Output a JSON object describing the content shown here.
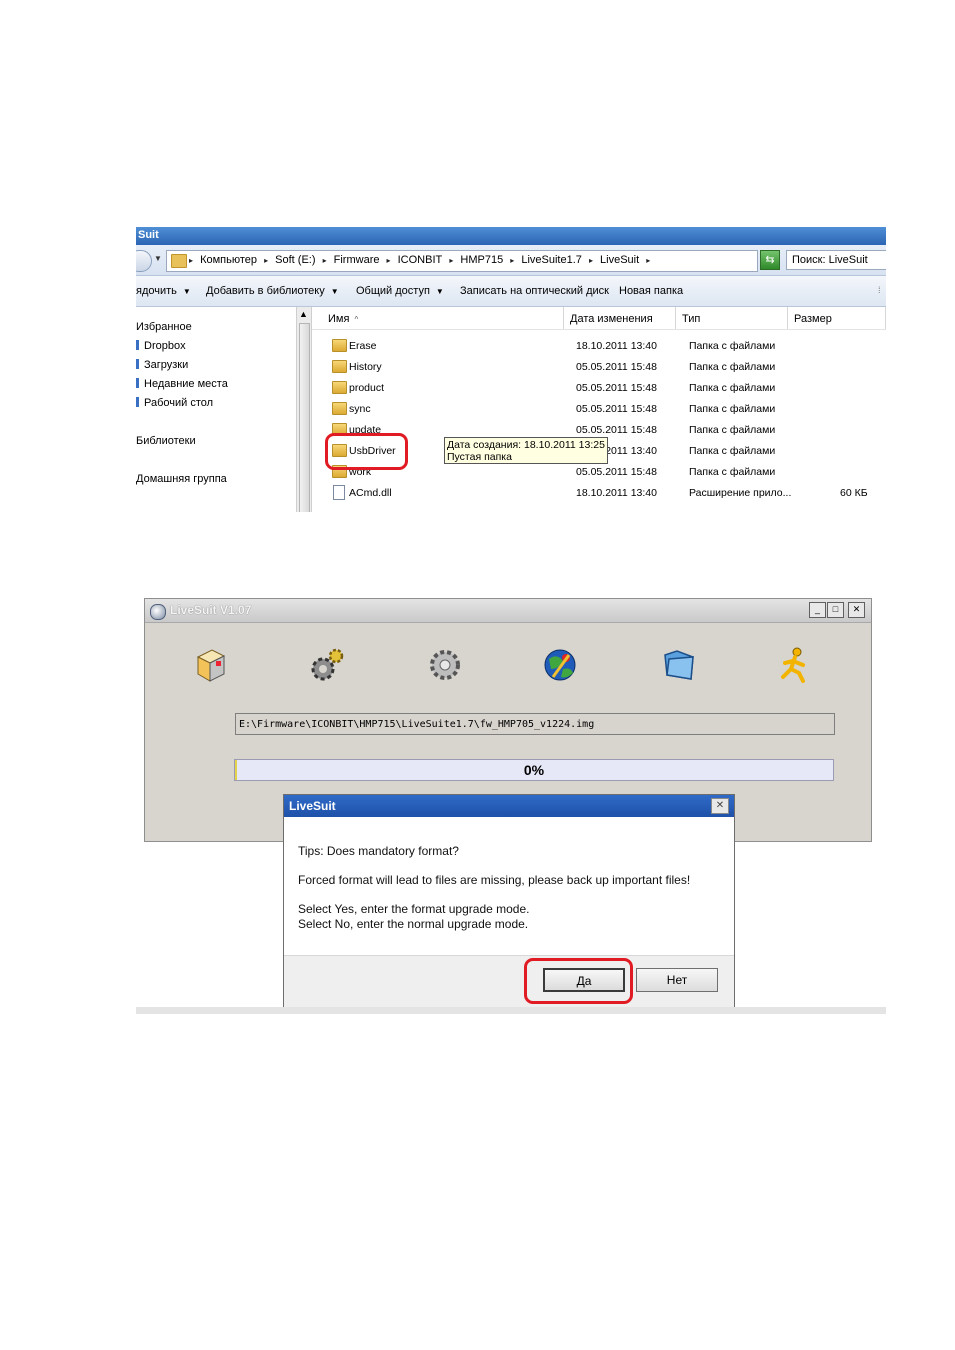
{
  "explorer": {
    "title": "Suit",
    "breadcrumbs": [
      "Компьютер",
      "Soft (E:)",
      "Firmware",
      "ICONBIT",
      "HMP715",
      "LiveSuite1.7",
      "LiveSuit"
    ],
    "search_placeholder": "Поиск: LiveSuit",
    "commands": [
      "ядочить",
      "Добавить в библиотеку",
      "Общий доступ",
      "Записать на оптический диск",
      "Новая папка"
    ],
    "nav": [
      "Избранное",
      "Dropbox",
      "Загрузки",
      "Недавние места",
      "Рабочий стол",
      "Библиотеки",
      "Домашняя группа"
    ],
    "columns": [
      "Имя",
      "Дата изменения",
      "Тип",
      "Размер"
    ],
    "rows": [
      {
        "name": "Erase",
        "date": "18.10.2011 13:40",
        "type": "Папка с файлами",
        "size": ""
      },
      {
        "name": "History",
        "date": "05.05.2011 15:48",
        "type": "Папка с файлами",
        "size": ""
      },
      {
        "name": "product",
        "date": "05.05.2011 15:48",
        "type": "Папка с файлами",
        "size": ""
      },
      {
        "name": "sync",
        "date": "05.05.2011 15:48",
        "type": "Папка с файлами",
        "size": ""
      },
      {
        "name": "update",
        "date": "05.05.2011 15:48",
        "type": "Папка с файлами",
        "size": ""
      },
      {
        "name": "UsbDriver",
        "date": "18.10.2011 13:40",
        "type": "Папка с файлами",
        "size": ""
      },
      {
        "name": "work",
        "date": "05.05.2011 15:48",
        "type": "Папка с файлами",
        "size": ""
      },
      {
        "name": "ACmd.dll",
        "date": "18.10.2011 13:40",
        "type": "Расширение прило...",
        "size": "60 КБ"
      }
    ],
    "tooltip": {
      "line1": "Дата создания: 18.10.2011 13:25",
      "line2": "Пустая папка"
    }
  },
  "livesuit": {
    "title": "LiveSuit V1.07",
    "toolbar_icons": [
      "package-icon",
      "gears-icon",
      "gear-icon",
      "globe-icon",
      "folder-icon",
      "runner-icon"
    ],
    "image_path": "E:\\Firmware\\ICONBIT\\HMP715\\LiveSuite1.7\\fw_HMP705_v1224.img",
    "progress": 0,
    "progress_label": "0%"
  },
  "dialog": {
    "title": "LiveSuit",
    "lines": [
      "Tips: Does mandatory format?",
      "Forced format will lead to files are missing, please back up important files!",
      "Select Yes, enter the format upgrade mode.",
      "Select No, enter the normal upgrade mode."
    ],
    "yes_label": "Да",
    "no_label": "Нет"
  },
  "colors": {
    "highlight": "#e01b24",
    "titlebar": "#2b64b4",
    "progress_bg": "#e6e8f8"
  }
}
